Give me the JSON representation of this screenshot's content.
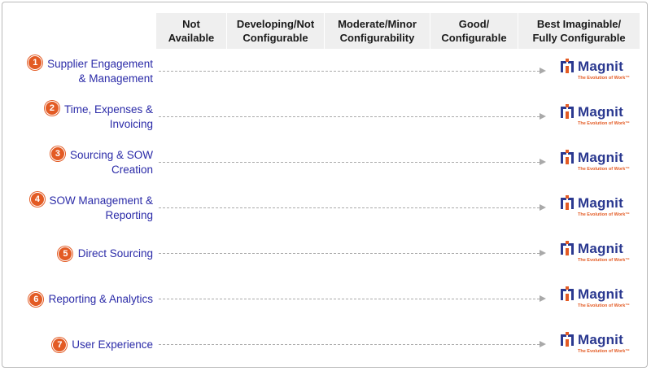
{
  "columns": [
    "Not\nAvailable",
    "Developing/Not\nConfigurable",
    "Moderate/Minor\nConfigurability",
    "Good/\nConfigurable",
    "Best Imaginable/\nFully Configurable"
  ],
  "rows": [
    {
      "number": "1",
      "label": "Supplier Engagement\n& Management"
    },
    {
      "number": "2",
      "label": "Time, Expenses &\nInvoicing"
    },
    {
      "number": "3",
      "label": "Sourcing & SOW\nCreation"
    },
    {
      "number": "4",
      "label": "SOW Management &\nReporting"
    },
    {
      "number": "5",
      "label": "Direct Sourcing"
    },
    {
      "number": "6",
      "label": "Reporting & Analytics"
    },
    {
      "number": "7",
      "label": "User Experience"
    }
  ],
  "logo": {
    "icon": "magnit-logo-icon",
    "word": "Magnit",
    "tagline": "The Evolution of Work™"
  },
  "colors": {
    "label_text": "#2b2ba8",
    "number_badge": "#e35b24",
    "logo_primary": "#2b3990",
    "logo_accent": "#e35b24",
    "header_bg": "#efefef",
    "connector": "#a9a9a9"
  }
}
